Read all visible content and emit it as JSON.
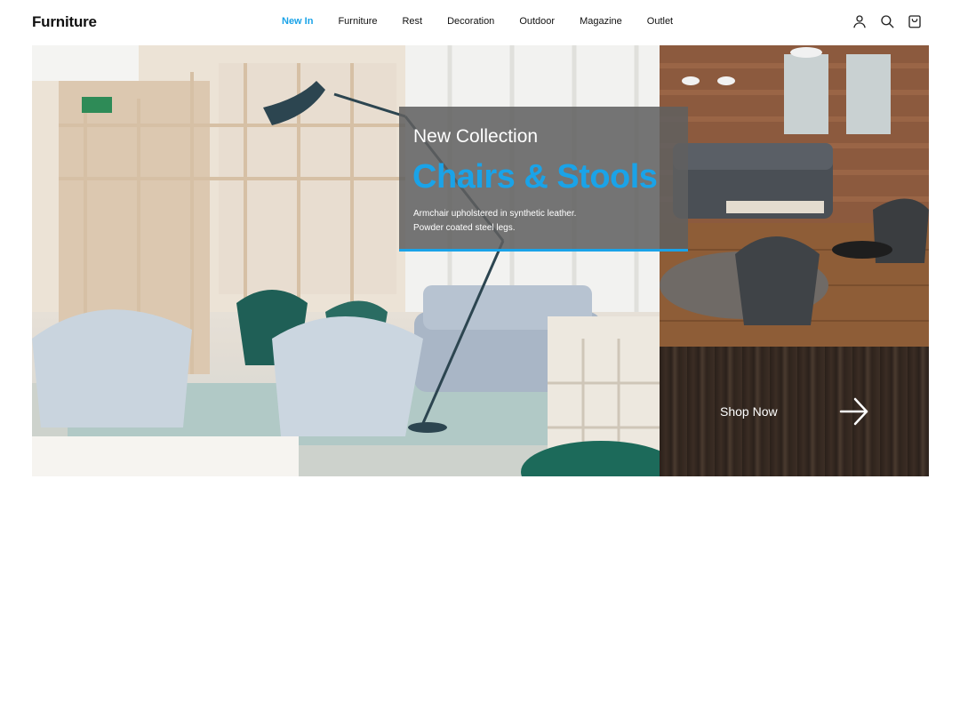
{
  "header": {
    "logo": "Furniture",
    "nav": [
      {
        "label": "New In",
        "active": true
      },
      {
        "label": "Furniture",
        "active": false
      },
      {
        "label": "Rest",
        "active": false
      },
      {
        "label": "Decoration",
        "active": false
      },
      {
        "label": "Outdoor",
        "active": false
      },
      {
        "label": "Magazine",
        "active": false
      },
      {
        "label": "Outlet",
        "active": false
      }
    ],
    "icons": [
      "user-icon",
      "search-icon",
      "shopping-bag-icon"
    ]
  },
  "promo": {
    "kicker": "New Collection",
    "title": "Chairs & Stools",
    "desc_line1": "Armchair upholstered in synthetic leather.",
    "desc_line2": "Powder coated steel legs."
  },
  "cta": {
    "label": "Shop Now",
    "icon": "arrow-right-icon"
  },
  "colors": {
    "accent": "#1aa3e8",
    "overlay": "#606060",
    "text": "#111111"
  }
}
